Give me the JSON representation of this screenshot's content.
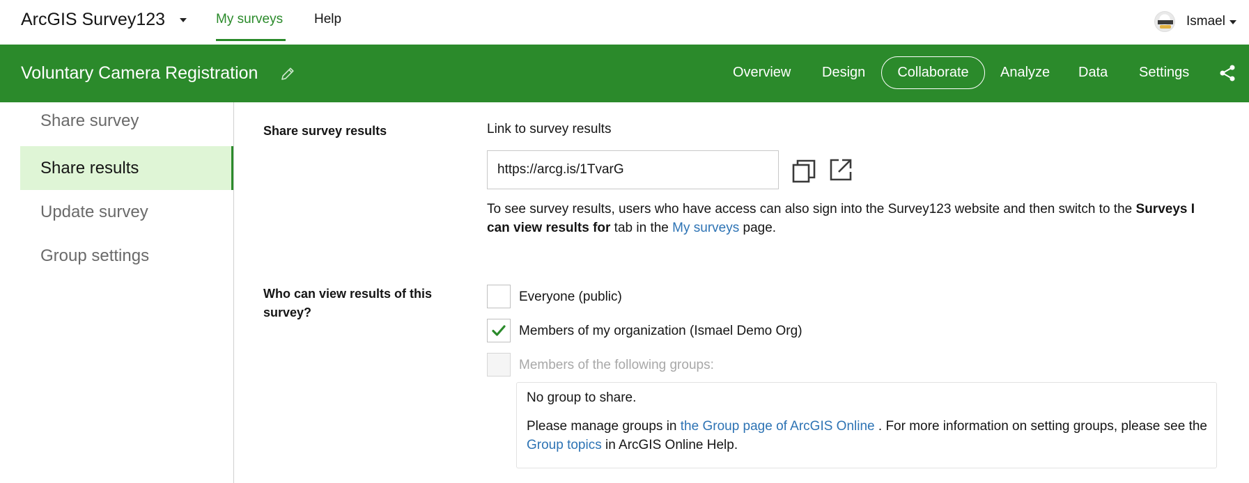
{
  "topbar": {
    "app_title": "ArcGIS Survey123",
    "nav": {
      "my_surveys": "My surveys",
      "help": "Help"
    },
    "user_name": "Ismael"
  },
  "header": {
    "survey_title": "Voluntary Camera Registration",
    "tabs": {
      "overview": "Overview",
      "design": "Design",
      "collaborate": "Collaborate",
      "analyze": "Analyze",
      "data": "Data",
      "settings": "Settings"
    },
    "active_tab": "Collaborate"
  },
  "sidebar": {
    "items": [
      {
        "label": "Share survey"
      },
      {
        "label": "Share results"
      },
      {
        "label": "Update survey"
      },
      {
        "label": "Group settings"
      }
    ],
    "active": "Share results"
  },
  "share_results": {
    "section_label": "Share survey results",
    "link_label": "Link to survey results",
    "url_value": "https://arcg.is/1TvarG",
    "info": {
      "part1": "To see survey results, users who have access can also sign into the Survey123 website and then switch to the ",
      "bold": "Surveys I can view results for",
      "part2": " tab in the ",
      "link": "My surveys",
      "part3": " page."
    }
  },
  "who_can_view": {
    "section_label": "Who can view results of this survey?",
    "options": [
      {
        "label": "Everyone (public)",
        "checked": false,
        "disabled": false
      },
      {
        "label": "Members of my organization (Ismael Demo Org)",
        "checked": true,
        "disabled": false
      },
      {
        "label": "Members of the following groups:",
        "checked": false,
        "disabled": true
      }
    ],
    "groups": {
      "empty": "No group to share.",
      "manage_part1": "Please manage groups in ",
      "manage_link1": "the Group page of ArcGIS Online",
      "manage_part2": " . For more information on setting groups, please see the ",
      "manage_link2": "Group topics",
      "manage_part3": " in ArcGIS Online Help."
    }
  },
  "colors": {
    "brand_green": "#2b8a2b",
    "active_side_bg": "#dff5d6",
    "link_blue": "#2d73b4"
  },
  "icons": [
    "chevron-down-icon",
    "pencil-icon",
    "share-icon",
    "copy-icon",
    "open-external-icon",
    "checkmark-icon",
    "user-avatar"
  ]
}
